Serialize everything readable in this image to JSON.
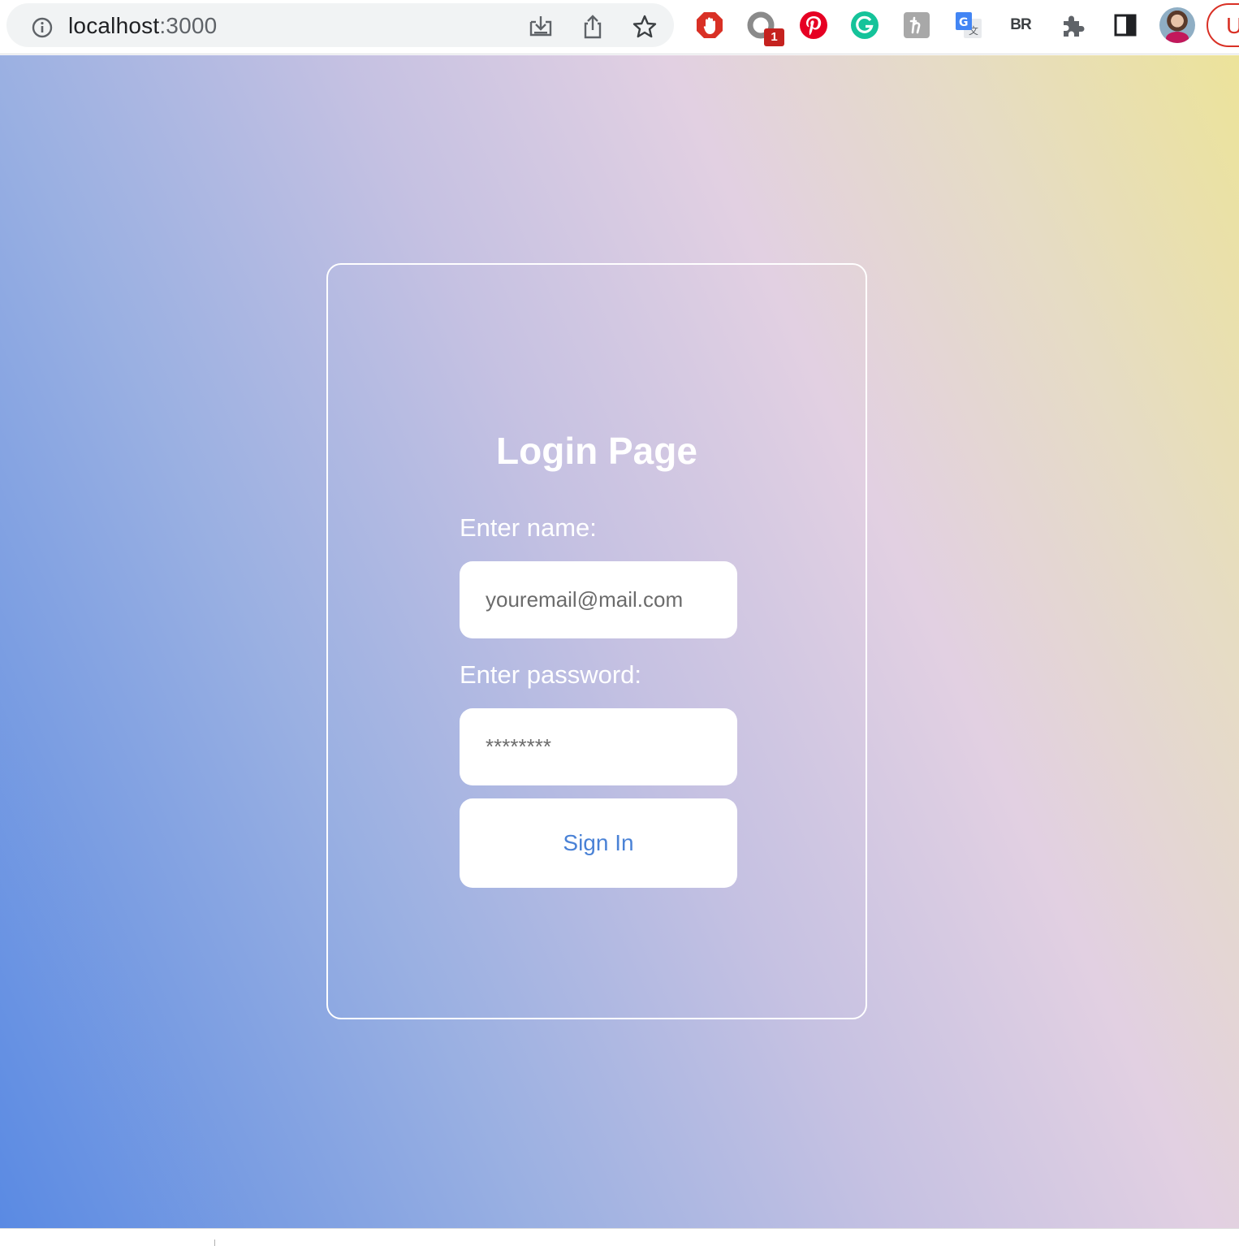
{
  "browser": {
    "url_host": "localhost",
    "url_port": ":3000",
    "extensions": [
      {
        "name": "adblock-icon",
        "color": "#d93025"
      },
      {
        "name": "circle-extension-icon",
        "color": "#8a8a8a",
        "badge": "1"
      },
      {
        "name": "pinterest-icon",
        "color": "#e60023"
      },
      {
        "name": "grammarly-icon",
        "color": "#15c39a"
      },
      {
        "name": "honey-icon",
        "color": "#a8a8a8"
      },
      {
        "name": "google-translate-icon",
        "color": "#4285f4"
      },
      {
        "name": "br-extension-icon",
        "label": "BR"
      },
      {
        "name": "extensions-puzzle-icon",
        "color": "#5f6368"
      },
      {
        "name": "side-panel-icon",
        "color": "#202124"
      }
    ],
    "update_label": "U"
  },
  "login": {
    "title": "Login Page",
    "name_label": "Enter name:",
    "name_placeholder": "youremail@mail.com",
    "password_label": "Enter password:",
    "password_placeholder": "********",
    "signin_label": "Sign In"
  },
  "colors": {
    "gradient_start": "#5a8ae3",
    "gradient_end": "#ece39a",
    "button_text": "#4a82d6"
  }
}
